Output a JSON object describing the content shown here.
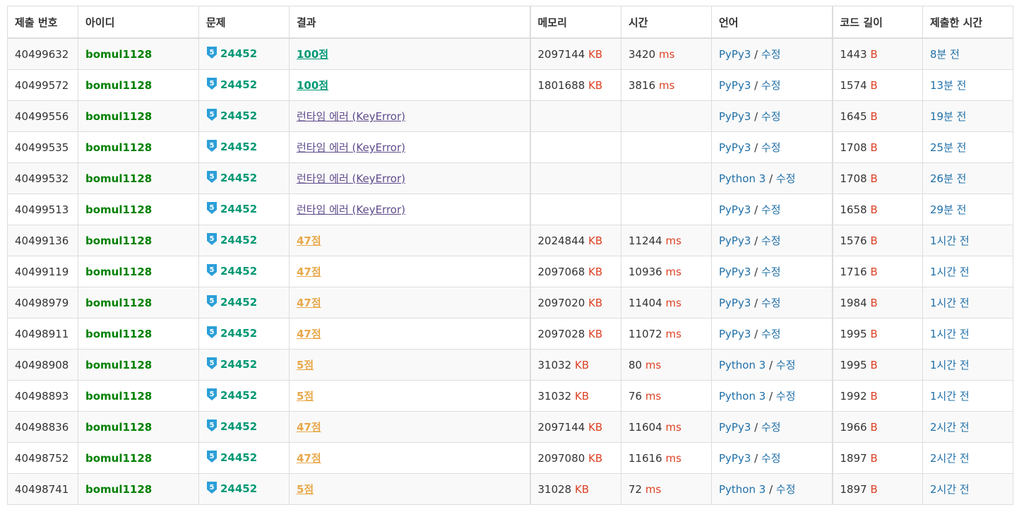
{
  "headers": {
    "submission_id": "제출 번호",
    "user_id": "아이디",
    "problem": "문제",
    "result": "결과",
    "memory": "메모리",
    "time": "시간",
    "language": "언어",
    "code_length": "코드 길이",
    "submitted_at": "제출한 시간"
  },
  "units": {
    "memory": "KB",
    "time": "ms",
    "code_length": "B"
  },
  "edit_label": "수정",
  "slash": " / ",
  "tier_icon": {
    "name": "tier-icon",
    "label": "5",
    "color": "#2b9fd8"
  },
  "colors": {
    "user": "#008000",
    "problem": "#009874",
    "accepted": "#009874",
    "partial": "#e8a84a",
    "runtime_error": "#5f4b8b",
    "unit": "#dd4124",
    "link": "#1f6fa8"
  },
  "rows": [
    {
      "id": "40499632",
      "user": "bomul1128",
      "problem": "24452",
      "result": "100점",
      "result_type": "ac",
      "memory": "2097144",
      "time": "3420",
      "language": "PyPy3",
      "code_length": "1443",
      "submitted": "8분 전"
    },
    {
      "id": "40499572",
      "user": "bomul1128",
      "problem": "24452",
      "result": "100점",
      "result_type": "ac",
      "memory": "1801688",
      "time": "3816",
      "language": "PyPy3",
      "code_length": "1574",
      "submitted": "13분 전"
    },
    {
      "id": "40499556",
      "user": "bomul1128",
      "problem": "24452",
      "result": "런타임 에러 (KeyError)",
      "result_type": "rte",
      "memory": "",
      "time": "",
      "language": "PyPy3",
      "code_length": "1645",
      "submitted": "19분 전"
    },
    {
      "id": "40499535",
      "user": "bomul1128",
      "problem": "24452",
      "result": "런타임 에러 (KeyError)",
      "result_type": "rte",
      "memory": "",
      "time": "",
      "language": "PyPy3",
      "code_length": "1708",
      "submitted": "25분 전"
    },
    {
      "id": "40499532",
      "user": "bomul1128",
      "problem": "24452",
      "result": "런타임 에러 (KeyError)",
      "result_type": "rte",
      "memory": "",
      "time": "",
      "language": "Python 3",
      "code_length": "1708",
      "submitted": "26분 전"
    },
    {
      "id": "40499513",
      "user": "bomul1128",
      "problem": "24452",
      "result": "런타임 에러 (KeyError)",
      "result_type": "rte",
      "memory": "",
      "time": "",
      "language": "PyPy3",
      "code_length": "1658",
      "submitted": "29분 전"
    },
    {
      "id": "40499136",
      "user": "bomul1128",
      "problem": "24452",
      "result": "47점",
      "result_type": "part",
      "memory": "2024844",
      "time": "11244",
      "language": "PyPy3",
      "code_length": "1576",
      "submitted": "1시간 전"
    },
    {
      "id": "40499119",
      "user": "bomul1128",
      "problem": "24452",
      "result": "47점",
      "result_type": "part",
      "memory": "2097068",
      "time": "10936",
      "language": "PyPy3",
      "code_length": "1716",
      "submitted": "1시간 전"
    },
    {
      "id": "40498979",
      "user": "bomul1128",
      "problem": "24452",
      "result": "47점",
      "result_type": "part",
      "memory": "2097020",
      "time": "11404",
      "language": "PyPy3",
      "code_length": "1984",
      "submitted": "1시간 전"
    },
    {
      "id": "40498911",
      "user": "bomul1128",
      "problem": "24452",
      "result": "47점",
      "result_type": "part",
      "memory": "2097028",
      "time": "11072",
      "language": "PyPy3",
      "code_length": "1995",
      "submitted": "1시간 전"
    },
    {
      "id": "40498908",
      "user": "bomul1128",
      "problem": "24452",
      "result": "5점",
      "result_type": "part",
      "memory": "31032",
      "time": "80",
      "language": "Python 3",
      "code_length": "1995",
      "submitted": "1시간 전"
    },
    {
      "id": "40498893",
      "user": "bomul1128",
      "problem": "24452",
      "result": "5점",
      "result_type": "part",
      "memory": "31032",
      "time": "76",
      "language": "Python 3",
      "code_length": "1992",
      "submitted": "1시간 전"
    },
    {
      "id": "40498836",
      "user": "bomul1128",
      "problem": "24452",
      "result": "47점",
      "result_type": "part",
      "memory": "2097144",
      "time": "11604",
      "language": "PyPy3",
      "code_length": "1966",
      "submitted": "2시간 전"
    },
    {
      "id": "40498752",
      "user": "bomul1128",
      "problem": "24452",
      "result": "47점",
      "result_type": "part",
      "memory": "2097080",
      "time": "11616",
      "language": "PyPy3",
      "code_length": "1897",
      "submitted": "2시간 전"
    },
    {
      "id": "40498741",
      "user": "bomul1128",
      "problem": "24452",
      "result": "5점",
      "result_type": "part",
      "memory": "31028",
      "time": "72",
      "language": "Python 3",
      "code_length": "1897",
      "submitted": "2시간 전"
    }
  ]
}
